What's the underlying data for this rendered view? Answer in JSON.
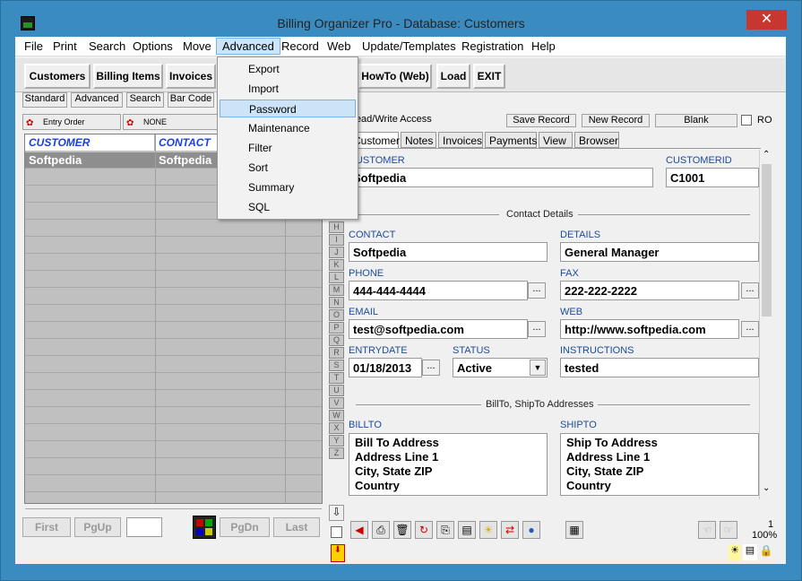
{
  "window": {
    "title": "Billing Organizer Pro - Database: Customers",
    "close": "✕"
  },
  "menubar": [
    "File",
    "Print",
    "Search",
    "Options",
    "Move",
    "Advanced",
    "Record",
    "Web",
    "Update/Templates",
    "Registration",
    "Help"
  ],
  "advanced_menu": [
    "Export",
    "Import",
    "Password",
    "Maintenance",
    "Filter",
    "Sort",
    "Summary",
    "SQL"
  ],
  "toolbar": {
    "customers": "Customers",
    "billing_items": "Billing Items",
    "invoices": "Invoices",
    "howto": "HowTo (Web)",
    "load": "Load",
    "exit": "EXIT"
  },
  "subtabs": [
    "Standard",
    "Advanced",
    "Search",
    "Bar Code"
  ],
  "order": {
    "entry": "Entry Order",
    "none": "NONE"
  },
  "grid": {
    "col1": "CUSTOMER",
    "col2": "CONTACT",
    "row1_customer": "Softpedia",
    "row1_contact": "Softpedia"
  },
  "alpha": [
    "H",
    "I",
    "J",
    "K",
    "L",
    "M",
    "N",
    "O",
    "P",
    "Q",
    "R",
    "S",
    "T",
    "U",
    "V",
    "W",
    "X",
    "Y",
    "Z"
  ],
  "access": {
    "label": "Read/Write Access",
    "save": "Save Record",
    "new": "New Record",
    "blank": "Blank",
    "ro": "RO"
  },
  "tabs": [
    "Customer",
    "Notes",
    "Invoices",
    "Payments",
    "View",
    "Browser"
  ],
  "form": {
    "customer_label": "CUSTOMER",
    "customer": "Softpedia",
    "customerid_label": "CUSTOMERID",
    "customerid": "C1001",
    "contact_details": "Contact Details",
    "contact_label": "CONTACT",
    "contact": "Softpedia",
    "details_label": "DETAILS",
    "details": "General Manager",
    "phone_label": "PHONE",
    "phone": "444-444-4444",
    "fax_label": "FAX",
    "fax": "222-222-2222",
    "email_label": "EMAIL",
    "email": "test@softpedia.com",
    "web_label": "WEB",
    "web": "http://www.softpedia.com",
    "entrydate_label": "ENTRYDATE",
    "entrydate": "01/18/2013",
    "status_label": "STATUS",
    "status": "Active",
    "instructions_label": "INSTRUCTIONS",
    "instructions": "tested",
    "addresses": "BillTo, ShipTo Addresses",
    "billto_label": "BILLTO",
    "billto": [
      "Bill To Address",
      "Address Line 1",
      "City,  State  ZIP",
      "Country"
    ],
    "shipto_label": "SHIPTO",
    "shipto": [
      "Ship To Address",
      "Address Line 1",
      "City,  State  ZIP",
      "Country"
    ]
  },
  "nav": {
    "first": "First",
    "pgup": "PgUp",
    "pgdn": "PgDn",
    "last": "Last"
  },
  "status": {
    "count": "1",
    "zoom": "100%"
  },
  "dots": "..."
}
